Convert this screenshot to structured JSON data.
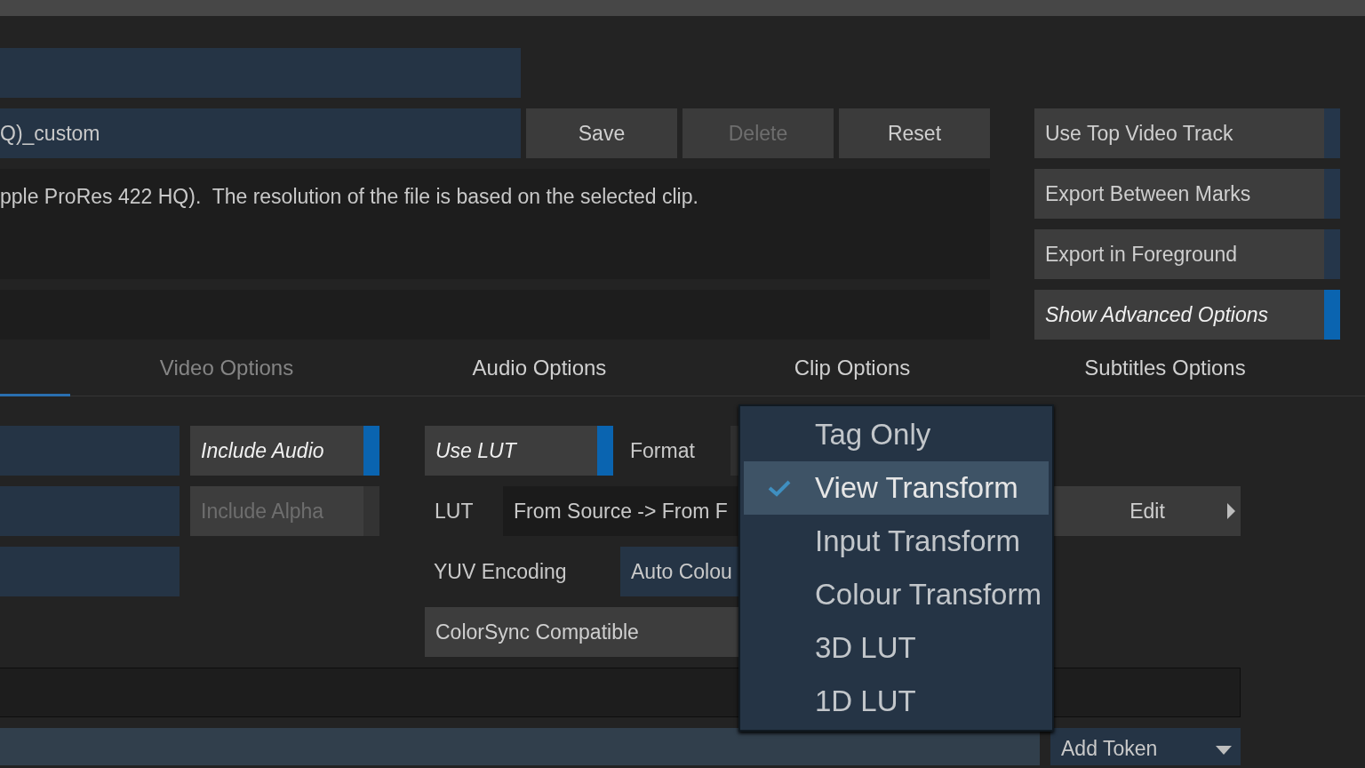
{
  "preset_field": {
    "value": "Q)_custom"
  },
  "preset_buttons": [
    {
      "label": "Save",
      "disabled": false
    },
    {
      "label": "Delete",
      "disabled": true
    },
    {
      "label": "Reset",
      "disabled": false
    }
  ],
  "description": "pple ProRes 422 HQ).  The resolution of the file is based on the selected clip.",
  "options": [
    {
      "label": "Use Top Video Track",
      "on": false
    },
    {
      "label": "Export Between Marks",
      "on": false
    },
    {
      "label": "Export in Foreground",
      "on": false
    },
    {
      "label": "Show Advanced Options",
      "on": true
    }
  ],
  "tabs": [
    {
      "selected": true
    },
    {
      "label": "Video Options",
      "selected": false,
      "disabled": true
    },
    {
      "label": "Audio Options",
      "selected": false,
      "disabled": false
    },
    {
      "label": "Clip Options",
      "selected": false,
      "disabled": false
    },
    {
      "label": "Subtitles Options",
      "selected": false,
      "disabled": false
    }
  ],
  "video_toggles": [
    {
      "label": "Include Audio",
      "on": true,
      "disabled": false
    },
    {
      "label": "Include Alpha",
      "on": false,
      "disabled": true
    }
  ],
  "clip": {
    "use_lut": {
      "label": "Use LUT",
      "on": true
    },
    "format_label": "Format",
    "lut_label": "LUT",
    "lut_value": "From Source -> From F",
    "edit_button": "Edit",
    "yuv_label": "YUV Encoding",
    "yuv_value": "Auto Colou",
    "colorsync": "ColorSync Compatible"
  },
  "add_token": "Add Token",
  "menu": [
    {
      "label": "Tag Only",
      "selected": false
    },
    {
      "label": "View Transform",
      "selected": true
    },
    {
      "label": "Input Transform",
      "selected": false
    },
    {
      "label": "Colour Transform",
      "selected": false
    },
    {
      "label": "3D LUT",
      "selected": false
    },
    {
      "label": "1D LUT",
      "selected": false
    }
  ]
}
